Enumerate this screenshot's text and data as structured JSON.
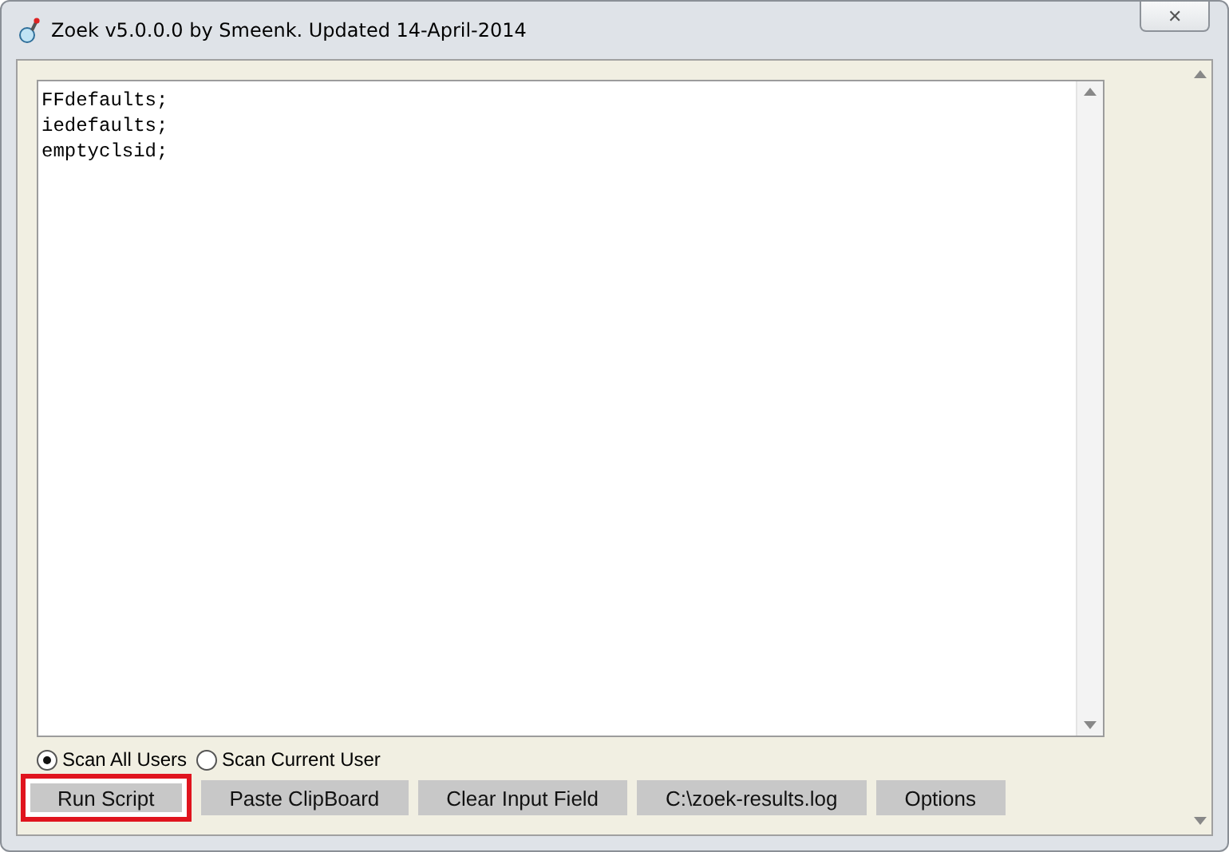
{
  "window": {
    "title": "Zoek v5.0.0.0 by Smeenk. Updated 14-April-2014",
    "close": "✕"
  },
  "script_lines": [
    "FFdefaults;",
    "iedefaults;",
    "emptyclsid;"
  ],
  "scan_options": [
    {
      "label": "Scan All Users",
      "selected": true
    },
    {
      "label": "Scan Current User",
      "selected": false
    }
  ],
  "buttons": [
    {
      "label": "Run Script",
      "highlighted": true
    },
    {
      "label": "Paste ClipBoard",
      "highlighted": false
    },
    {
      "label": "Clear Input Field",
      "highlighted": false
    },
    {
      "label": "C:\\zoek-results.log",
      "highlighted": false
    },
    {
      "label": "Options",
      "highlighted": false
    }
  ]
}
